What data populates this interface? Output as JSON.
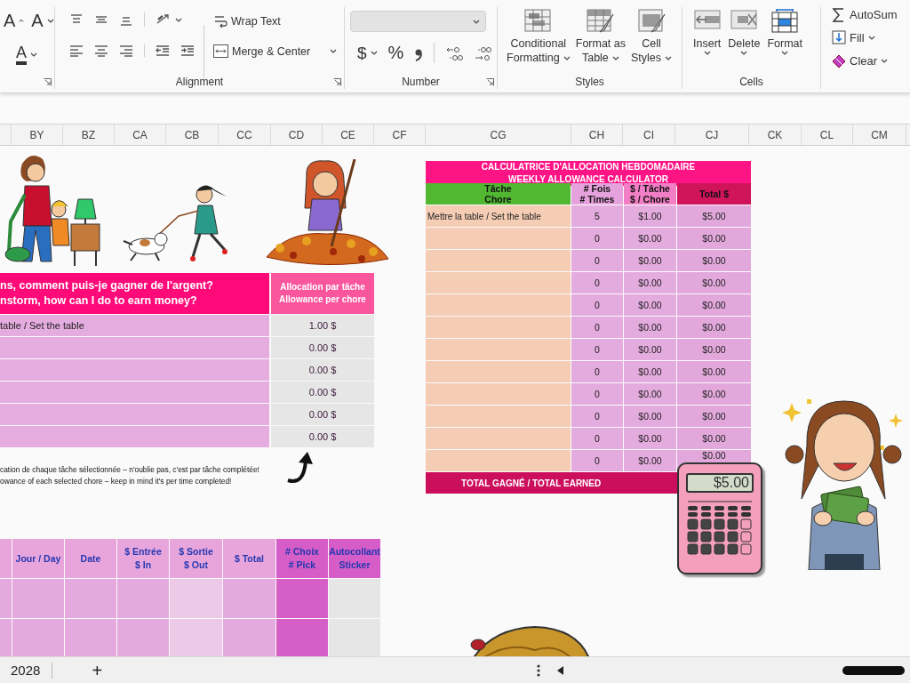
{
  "ribbon": {
    "font_buttons": [
      {
        "kind": "grow",
        "glyph": "A"
      },
      {
        "kind": "shrink",
        "glyph": "A"
      },
      {
        "kind": "color",
        "glyph": "A"
      }
    ],
    "alignment": {
      "label": "Alignment",
      "wrap_text": "Wrap Text",
      "merge_center": "Merge & Center"
    },
    "number": {
      "label": "Number",
      "format_dropdown": {
        "disabled": true
      },
      "currency": "$",
      "percent": "%"
    },
    "styles": {
      "label": "Styles",
      "buttons": [
        {
          "kind": "conditional",
          "lines": [
            "Conditional",
            "Formatting"
          ]
        },
        {
          "kind": "table",
          "lines": [
            "Format as",
            "Table"
          ]
        },
        {
          "kind": "cell",
          "lines": [
            "Cell",
            "Styles"
          ]
        }
      ]
    },
    "cells": {
      "label": "Cells",
      "buttons": [
        {
          "kind": "insert",
          "label": "Insert"
        },
        {
          "kind": "delete",
          "label": "Delete"
        },
        {
          "kind": "format",
          "label": "Format"
        }
      ]
    },
    "editing": {
      "buttons": [
        {
          "kind": "autosum",
          "label": "AutoSum"
        },
        {
          "kind": "fill",
          "label": "Fill"
        },
        {
          "kind": "clear",
          "label": "Clear"
        }
      ]
    }
  },
  "column_headers": [
    "BY",
    "BZ",
    "CA",
    "CB",
    "CC",
    "CD",
    "CE",
    "CF",
    "CG",
    "CH",
    "CI",
    "CJ",
    "CK",
    "CL",
    "CM"
  ],
  "chores_table": {
    "header": [
      "ns, comment puis-je gagner de l'argent?",
      "nstorm, how can I do to earn money?"
    ],
    "allowance_header": [
      "Allocation par tâche",
      "Allowance per chore"
    ],
    "rows": [
      {
        "chore": "table / Set the table",
        "allowance": "1.00 $"
      },
      {
        "allowance": "0.00 $"
      },
      {
        "allowance": "0.00 $"
      },
      {
        "allowance": "0.00 $"
      },
      {
        "allowance": "0.00 $"
      },
      {
        "allowance": "0.00 $"
      }
    ]
  },
  "notes": [
    "cation de chaque tâche sélectionnée – n'oublie pas, c'est par tâche complétée!",
    "owance of each selected chore – keep in mind it's per time completed!"
  ],
  "ledger": {
    "columns": [
      {
        "kind": "day",
        "lines": [
          "Jour / Day"
        ]
      },
      {
        "kind": "date",
        "lines": [
          "Date"
        ]
      },
      {
        "kind": "in",
        "lines": [
          "$ Entrée",
          "$ In"
        ]
      },
      {
        "kind": "out",
        "lines": [
          "$ Sortie",
          "$ Out"
        ]
      },
      {
        "kind": "total",
        "lines": [
          "$ Total"
        ]
      },
      {
        "kind": "pick",
        "lines": [
          "# Choix",
          "# Pick"
        ]
      },
      {
        "kind": "sticker",
        "lines": [
          "Autocollant",
          "Sticker"
        ]
      }
    ]
  },
  "calculator": {
    "title": [
      "CALCULATRICE D'ALLOCATION HEBDOMADAIRE",
      "WEEKLY ALLOWANCE CALCULATOR"
    ],
    "columns": [
      {
        "kind": "chore",
        "lines": [
          "Tâche",
          "Chore"
        ]
      },
      {
        "kind": "times",
        "lines": [
          "# Fois",
          "# Times"
        ]
      },
      {
        "kind": "per_chore",
        "lines": [
          "$ / Tâche",
          "$ / Chore"
        ]
      },
      {
        "kind": "total",
        "lines": [
          "Total $"
        ]
      }
    ],
    "rows": [
      {
        "chore": "Mettre la table / Set the table",
        "times": "5",
        "per_chore": "$1.00",
        "total": "$5.00"
      },
      {
        "times": "0",
        "per_chore": "$0.00",
        "total": "$0.00"
      },
      {
        "times": "0",
        "per_chore": "$0.00",
        "total": "$0.00"
      },
      {
        "times": "0",
        "per_chore": "$0.00",
        "total": "$0.00"
      },
      {
        "times": "0",
        "per_chore": "$0.00",
        "total": "$0.00"
      },
      {
        "times": "0",
        "per_chore": "$0.00",
        "total": "$0.00"
      },
      {
        "times": "0",
        "per_chore": "$0.00",
        "total": "$0.00"
      },
      {
        "times": "0",
        "per_chore": "$0.00",
        "total": "$0.00"
      },
      {
        "times": "0",
        "per_chore": "$0.00",
        "total": "$0.00"
      },
      {
        "times": "0",
        "per_chore": "$0.00",
        "total": "$0.00"
      },
      {
        "times": "0",
        "per_chore": "$0.00",
        "total": "$0.00"
      },
      {
        "times": "0",
        "per_chore": "$0.00",
        "total": "$0.00"
      }
    ],
    "total_label": "TOTAL GAGNÉ / TOTAL EARNED"
  },
  "calculator_display": "$5.00",
  "status_bar": {
    "sheet_tab": "2028",
    "add_sheet": "+"
  }
}
